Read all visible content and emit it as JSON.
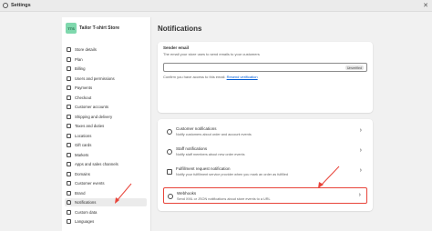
{
  "window": {
    "title": "Settings",
    "close_glyph": "✕"
  },
  "store": {
    "initials": "TTS",
    "name": "Tailor T-shirt Store"
  },
  "sidebar": {
    "items": [
      {
        "label": "Store details",
        "icon": "store-icon"
      },
      {
        "label": "Plan",
        "icon": "plan-icon"
      },
      {
        "label": "Billing",
        "icon": "billing-icon"
      },
      {
        "label": "Users and permissions",
        "icon": "users-icon"
      },
      {
        "label": "Payments",
        "icon": "payments-icon"
      },
      {
        "label": "Checkout",
        "icon": "checkout-icon"
      },
      {
        "label": "Customer accounts",
        "icon": "customer-accounts-icon"
      },
      {
        "label": "Shipping and delivery",
        "icon": "shipping-icon"
      },
      {
        "label": "Taxes and duties",
        "icon": "taxes-icon"
      },
      {
        "label": "Locations",
        "icon": "location-icon"
      },
      {
        "label": "Gift cards",
        "icon": "gift-card-icon"
      },
      {
        "label": "Markets",
        "icon": "markets-icon"
      },
      {
        "label": "Apps and sales channels",
        "icon": "apps-icon"
      },
      {
        "label": "Domains",
        "icon": "domains-icon"
      },
      {
        "label": "Customer events",
        "icon": "customer-events-icon"
      },
      {
        "label": "Brand",
        "icon": "brand-icon"
      },
      {
        "label": "Notifications",
        "icon": "bell-icon",
        "active": true
      },
      {
        "label": "Custom data",
        "icon": "custom-data-icon"
      },
      {
        "label": "Languages",
        "icon": "languages-icon"
      }
    ]
  },
  "main": {
    "title": "Notifications",
    "sender": {
      "label": "Sender email",
      "description": "The email your store uses to send emails to your customers",
      "value": "",
      "badge": "Unverified",
      "hint": "Confirm you have access to this email.",
      "link": "Resend verification"
    },
    "rows": [
      {
        "title": "Customer notifications",
        "description": "Notify customers about order and account events",
        "icon": "customer-icon"
      },
      {
        "title": "Staff notifications",
        "description": "Notify staff members about new order events",
        "icon": "staff-icon"
      },
      {
        "title": "Fulfillment request notification",
        "description": "Notify your fulfillment service provider when you mark an order as fulfilled",
        "icon": "fulfillment-icon"
      },
      {
        "title": "Webhooks",
        "description": "Send XML or JSON notifications about store events to a URL",
        "icon": "webhook-icon",
        "highlighted": true
      }
    ],
    "chevron": "›"
  },
  "colors": {
    "highlight": "#e8443a",
    "avatar": "#7fd8ad",
    "link": "#005bd3"
  }
}
